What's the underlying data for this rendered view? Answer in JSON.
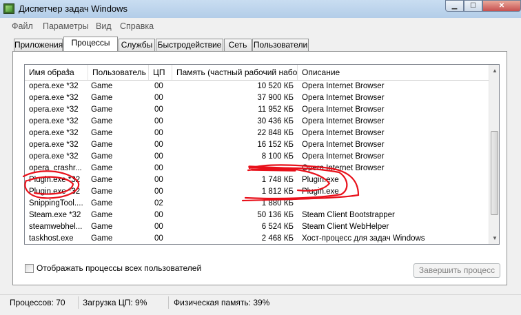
{
  "window": {
    "title": "Диспетчер задач Windows"
  },
  "menu": [
    {
      "label": "Файл"
    },
    {
      "label": "Параметры"
    },
    {
      "label": "Вид"
    },
    {
      "label": "Справка"
    }
  ],
  "tabs": [
    {
      "label": "Приложения"
    },
    {
      "label": "Процессы",
      "active": true
    },
    {
      "label": "Службы"
    },
    {
      "label": "Быстродействие"
    },
    {
      "label": "Сеть"
    },
    {
      "label": "Пользователи"
    }
  ],
  "table": {
    "columns": [
      {
        "label": "Имя образа",
        "sorted": true
      },
      {
        "label": "Пользователь"
      },
      {
        "label": "ЦП"
      },
      {
        "label": "Память (частный рабочий набор)"
      },
      {
        "label": "Описание"
      }
    ],
    "rows": [
      {
        "name": "opera.exe *32",
        "user": "Game",
        "cpu": "00",
        "mem": "10 520 КБ",
        "desc": "Opera Internet Browser"
      },
      {
        "name": "opera.exe *32",
        "user": "Game",
        "cpu": "00",
        "mem": "37 900 КБ",
        "desc": "Opera Internet Browser"
      },
      {
        "name": "opera.exe *32",
        "user": "Game",
        "cpu": "00",
        "mem": "11 952 КБ",
        "desc": "Opera Internet Browser"
      },
      {
        "name": "opera.exe *32",
        "user": "Game",
        "cpu": "00",
        "mem": "30 436 КБ",
        "desc": "Opera Internet Browser"
      },
      {
        "name": "opera.exe *32",
        "user": "Game",
        "cpu": "00",
        "mem": "22 848 КБ",
        "desc": "Opera Internet Browser"
      },
      {
        "name": "opera.exe *32",
        "user": "Game",
        "cpu": "00",
        "mem": "16 152 КБ",
        "desc": "Opera Internet Browser"
      },
      {
        "name": "opera.exe *32",
        "user": "Game",
        "cpu": "00",
        "mem": "8 100 КБ",
        "desc": "Opera Internet Browser"
      },
      {
        "name": "opera_crashr...",
        "user": "Game",
        "cpu": "00",
        "mem": "",
        "desc": "Opera Internet Browser"
      },
      {
        "name": "Plugin.exe *32",
        "user": "Game",
        "cpu": "00",
        "mem": "1 748 КБ",
        "desc": "Plugin.exe"
      },
      {
        "name": "Plugin.exe *32",
        "user": "Game",
        "cpu": "00",
        "mem": "1 812 КБ",
        "desc": "Plugin.exe"
      },
      {
        "name": "SnippingTool....",
        "user": "Game",
        "cpu": "02",
        "mem": "1 880 КБ",
        "desc": ""
      },
      {
        "name": "Steam.exe *32",
        "user": "Game",
        "cpu": "00",
        "mem": "50 136 КБ",
        "desc": "Steam Client Bootstrapper"
      },
      {
        "name": "steamwebhel...",
        "user": "Game",
        "cpu": "00",
        "mem": "6 524 КБ",
        "desc": "Steam Client WebHelper"
      },
      {
        "name": "taskhost.exe",
        "user": "Game",
        "cpu": "00",
        "mem": "2 468 КБ",
        "desc": "Хост-процесс для задач Windows"
      }
    ]
  },
  "show_all_users": {
    "label": "Отображать процессы всех пользователей",
    "checked": false
  },
  "end_process_button": {
    "label": "Завершить процесс",
    "enabled": false
  },
  "status": {
    "processes": "Процессов: 70",
    "cpu": "Загрузка ЦП: 9%",
    "memory": "Физическая память: 39%"
  },
  "colors": {
    "scribble": "#e8101a",
    "title_bar": "#bcd4ee"
  }
}
